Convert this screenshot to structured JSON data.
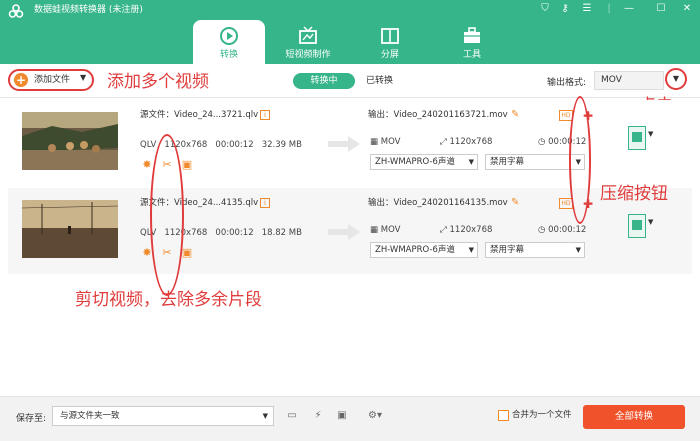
{
  "app": {
    "title": "数据蛙视频转换器 (未注册)"
  },
  "window_controls": [
    {
      "name": "cart-icon",
      "glyph": "⛉"
    },
    {
      "name": "key-icon",
      "glyph": "⚷"
    },
    {
      "name": "menu-icon",
      "glyph": "☰"
    },
    {
      "name": "minimize-icon",
      "glyph": "—"
    },
    {
      "name": "maximize-icon",
      "glyph": "☐"
    },
    {
      "name": "close-icon",
      "glyph": "✕"
    }
  ],
  "tabs": [
    {
      "label": "转换",
      "icon": "convert-icon",
      "active": true
    },
    {
      "label": "短视频制作",
      "icon": "tv-icon",
      "active": false
    },
    {
      "label": "分屏",
      "icon": "split-screen-icon",
      "active": false
    },
    {
      "label": "工具",
      "icon": "toolbox-icon",
      "active": false
    }
  ],
  "toolbar": {
    "add_file_label": "添加文件",
    "converting_label": "转换中",
    "converted_label": "已转换",
    "output_format_label": "输出格式:",
    "output_format_value": "MOV"
  },
  "annotations": {
    "add_multiple": "添加多个视频",
    "click": "点击",
    "compress_button": "压缩按钮",
    "trim": "剪切视频，去除多余片段"
  },
  "files": [
    {
      "source_name": "源文件：Video_24...3721.qlv",
      "format": "QLV",
      "resolution": "1120x768",
      "duration": "00:00:12",
      "size": "32.39 MB",
      "output_name": "输出：Video_240201163721.mov",
      "output_format": "MOV",
      "output_resolution": "1120x768",
      "output_duration": "00:00:12",
      "audio_track": "ZH-WMAPRO-6声道",
      "subtitle": "禁用字幕"
    },
    {
      "source_name": "源文件：Video_24...4135.qlv",
      "format": "QLV",
      "resolution": "1120x768",
      "duration": "00:00:12",
      "size": "18.82 MB",
      "output_name": "输出：Video_240201164135.mov",
      "output_format": "MOV",
      "output_resolution": "1120x768",
      "output_duration": "00:00:12",
      "audio_track": "ZH-WMAPRO-6声道",
      "subtitle": "禁用字幕"
    }
  ],
  "footer": {
    "save_to_label": "保存至:",
    "save_to_value": "与源文件夹一致",
    "merge_label": "合并为一个文件",
    "convert_all_label": "全部转换"
  },
  "colors": {
    "brand": "#37b58a",
    "accent": "#f08a2c",
    "annotation": "#e03c3c",
    "convert_button": "#f0522c"
  }
}
